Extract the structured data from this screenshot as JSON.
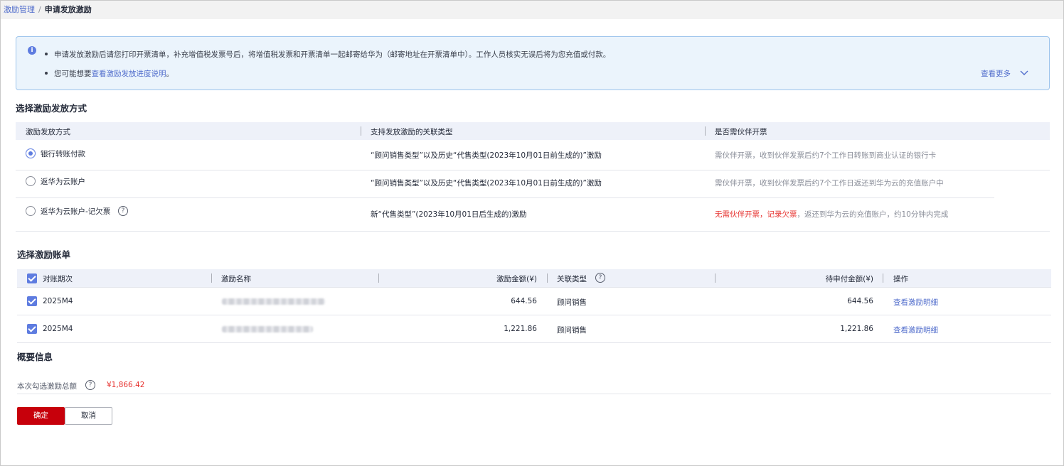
{
  "breadcrumb": {
    "parent": "激励管理",
    "separator": "/",
    "current": "申请发放激励"
  },
  "notice": {
    "line1": "申请发放激励后请您打印开票清单，补充增值税发票号后，将增值税发票和开票清单一起邮寄给华为（邮寄地址在开票清单中）。工作人员核实无误后将为您充值或付款。",
    "line2_prefix": "您可能想要",
    "line2_link": "查看激励发放进度说明",
    "line2_suffix": "。",
    "more_label": "查看更多"
  },
  "method_section": {
    "title": "选择激励发放方式",
    "headers": [
      "激励发放方式",
      "支持发放激励的关联类型",
      "是否需伙伴开票"
    ],
    "rows": [
      {
        "method": "银行转账付款",
        "selected": true,
        "type": "“顾问销售类型”以及历史“代售类型(2023年10月01日前生成的)”激励",
        "invoice": "需伙伴开票，收到伙伴发票后约7个工作日转账到商业认证的银行卡"
      },
      {
        "method": "返华为云账户",
        "selected": false,
        "type": "“顾问销售类型”以及历史“代售类型(2023年10月01日前生成的)”激励",
        "invoice": "需伙伴开票，收到伙伴发票后约7个工作日返还到华为云的充值账户中"
      },
      {
        "method": "返华为云账户-记欠票",
        "selected": false,
        "type": "新“代售类型”(2023年10月01日后生成的)激励",
        "invoice_red": "无需伙伴开票，记录欠票",
        "invoice_rest": "，返还到华为云的充值账户，约10分钟内完成"
      }
    ]
  },
  "bill_section": {
    "title": "选择激励账单",
    "headers": {
      "period": "对账期次",
      "name": "激励名称",
      "amount": "激励金额(¥)",
      "type": "关联类型",
      "pending": "待申付金额(¥)",
      "action": "操作"
    },
    "rows": [
      {
        "period": "2025M4",
        "amount": "644.56",
        "type": "顾问销售",
        "pending": "644.56",
        "action": "查看激励明细",
        "checked": true
      },
      {
        "period": "2025M4",
        "amount": "1,221.86",
        "type": "顾问销售",
        "pending": "1,221.86",
        "action": "查看激励明细",
        "checked": true
      }
    ]
  },
  "summary": {
    "title": "概要信息",
    "label": "本次勾选激励总额",
    "total": "¥1,866.42"
  },
  "buttons": {
    "confirm": "确定",
    "cancel": "取消"
  },
  "colors": {
    "primary_button": "#c7000b",
    "link": "#526ecc",
    "accent": "#5e7ce0",
    "danger_text": "#e6312e",
    "notice_bg": "#ebf4fc"
  },
  "icons": {
    "info": "info-icon",
    "help": "question-circle-icon",
    "expand": "chevron-down-icon",
    "check": "checkbox-checked-icon"
  }
}
